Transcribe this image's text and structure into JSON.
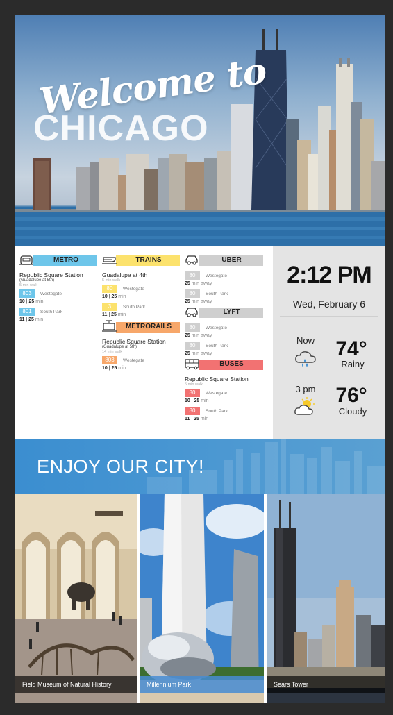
{
  "hero": {
    "welcome": "Welcome to",
    "city": "CHICAGO"
  },
  "transit": {
    "metro": {
      "label": "METRO",
      "color": "#6ec6ea",
      "icon": "metro-icon",
      "station": "Republic Square Station",
      "substation": "(Guadalupe at 5th)",
      "walk": "5 min walk",
      "routes": [
        {
          "num": "803",
          "dest": "Westegate",
          "t1": "10",
          "t2": "25",
          "unit": "min"
        },
        {
          "num": "801",
          "dest": "South Park",
          "t1": "11",
          "t2": "25",
          "unit": "min"
        }
      ]
    },
    "trains": {
      "label": "TRAINS",
      "color": "#fce26d",
      "icon": "train-icon",
      "station": "Guadalupe at 4th",
      "walk": "5 min walk",
      "routes": [
        {
          "num": "80",
          "dest": "Westegate",
          "t1": "10",
          "t2": "25",
          "unit": "min"
        },
        {
          "num": "3",
          "dest": "South Park",
          "t1": "11",
          "t2": "25",
          "unit": "min"
        }
      ]
    },
    "metrorails": {
      "label": "METRORAILS",
      "color": "#f7a76a",
      "icon": "metrorail-icon",
      "station": "Republic Square Station",
      "substation": "(Guadalupe at 5th)",
      "walk": "14 min walk",
      "routes": [
        {
          "num": "803",
          "dest": "Westegate",
          "t1": "10",
          "t2": "25",
          "unit": "min"
        }
      ]
    },
    "uber": {
      "label": "UBER",
      "color": "#cfcfcf",
      "icon": "car-icon",
      "routes": [
        {
          "num": "80",
          "dest": "Westegate",
          "away": "25",
          "away_unit": "min away"
        },
        {
          "num": "80",
          "dest": "South Park",
          "away": "25",
          "away_unit": "min away"
        }
      ]
    },
    "lyft": {
      "label": "LYFT",
      "color": "#cfcfcf",
      "icon": "car-icon",
      "routes": [
        {
          "num": "80",
          "dest": "Westegate",
          "away": "25",
          "away_unit": "min away"
        },
        {
          "num": "80",
          "dest": "South Park",
          "away": "25",
          "away_unit": "min away"
        }
      ]
    },
    "buses": {
      "label": "BUSES",
      "color": "#f27272",
      "icon": "bus-icon",
      "station": "Republic Square Station",
      "walk": "5 min walk",
      "routes": [
        {
          "num": "80",
          "dest": "Westegate",
          "t1": "10",
          "t2": "25",
          "unit": "min"
        },
        {
          "num": "80",
          "dest": "South Park",
          "t1": "11",
          "t2": "25",
          "unit": "min"
        }
      ]
    }
  },
  "clock": {
    "time": "2:12 PM",
    "date": "Wed, February 6",
    "now": {
      "label": "Now",
      "temp": "74°",
      "desc": "Rainy",
      "icon": "rain-cloud-icon"
    },
    "later": {
      "label": "3 pm",
      "temp": "76°",
      "desc": "Cloudy",
      "icon": "sun-cloud-icon"
    }
  },
  "enjoy": {
    "title": "ENJOY OUR CITY!"
  },
  "attractions": [
    {
      "caption": "Field Museum of Natural History"
    },
    {
      "caption": "Millennium Park"
    },
    {
      "caption": "Sears Tower"
    }
  ]
}
